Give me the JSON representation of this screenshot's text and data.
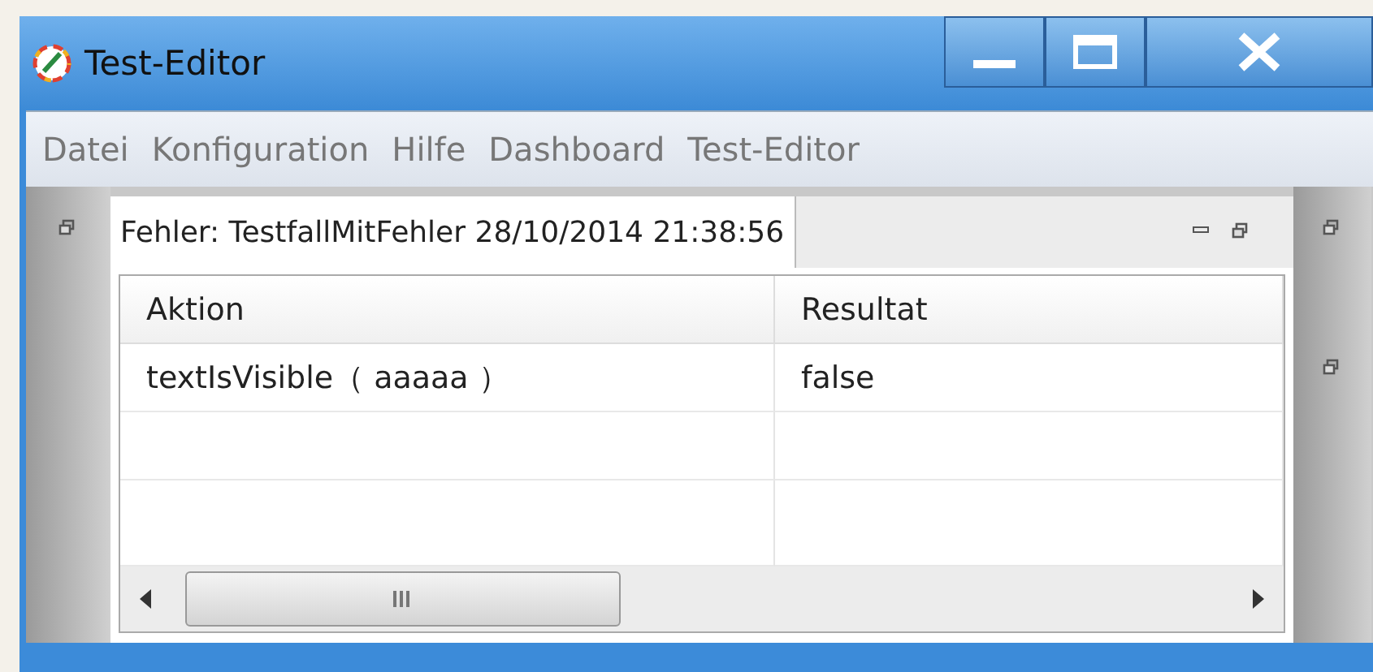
{
  "window": {
    "title": "Test-Editor"
  },
  "menu": [
    {
      "label": "Datei"
    },
    {
      "label": "Konfiguration"
    },
    {
      "label": "Hilfe"
    },
    {
      "label": "Dashboard"
    },
    {
      "label": "Test-Editor"
    }
  ],
  "editor_tab": {
    "title": "Fehler: TestfallMitFehler 28/10/2014 21:38:56",
    "selected": true
  },
  "table": {
    "columns": [
      "Aktion",
      "Resultat"
    ],
    "rows": [
      [
        "textIsVisible（ aaaaa ）",
        "false"
      ]
    ]
  }
}
